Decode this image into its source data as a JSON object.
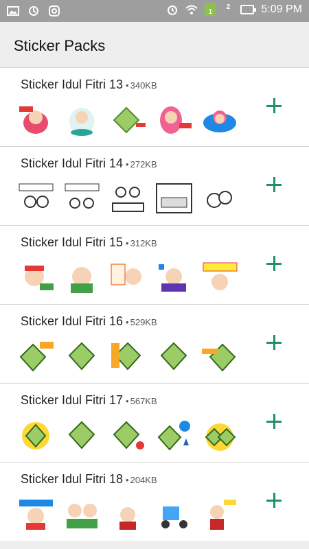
{
  "status_bar": {
    "time": "5:09 PM",
    "left_icons": [
      "gallery-icon",
      "sync-icon",
      "instagram-icon"
    ],
    "right_icons": [
      "alarm-icon",
      "wifi-icon",
      "signal-1-icon",
      "signal-2-icon",
      "battery-icon"
    ],
    "sim1": "1",
    "sim2": "2"
  },
  "app_bar": {
    "title": "Sticker Packs"
  },
  "packs": [
    {
      "name": "Sticker Idul Fitri 13",
      "size": "340KB"
    },
    {
      "name": "Sticker Idul Fitri 14",
      "size": "272KB"
    },
    {
      "name": "Sticker Idul Fitri 15",
      "size": "312KB"
    },
    {
      "name": "Sticker Idul Fitri 16",
      "size": "529KB"
    },
    {
      "name": "Sticker Idul Fitri 17",
      "size": "567KB"
    },
    {
      "name": "Sticker Idul Fitri 18",
      "size": "204KB"
    }
  ],
  "separator": "•",
  "colors": {
    "accent": "#1e8f6e",
    "status_bar": "#9e9e9e",
    "background": "#eeeeee"
  }
}
